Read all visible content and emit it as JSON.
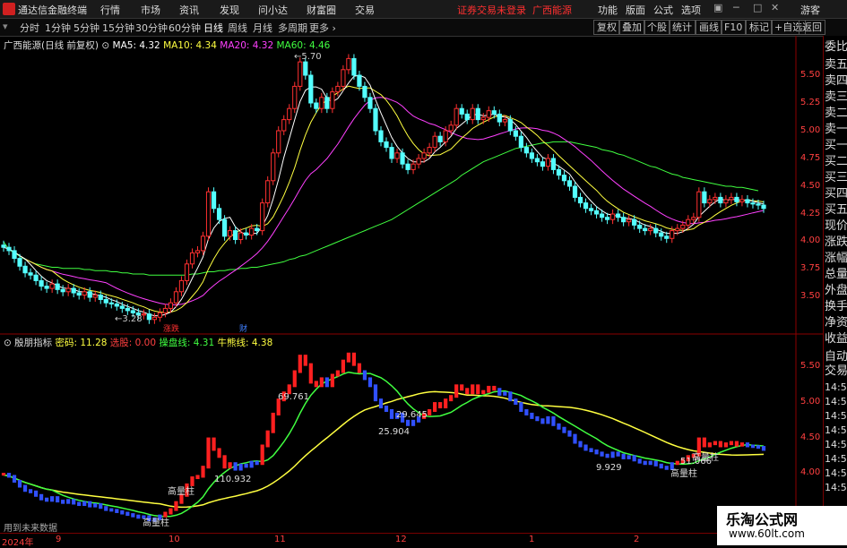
{
  "app": {
    "title": "通达信金融终端",
    "notice": "证券交易未登录",
    "stock_name": "广西能源"
  },
  "menu": [
    "行情",
    "市场",
    "资讯",
    "发现",
    "问小达",
    "财富圈",
    "交易"
  ],
  "right_menu": [
    "功能",
    "版面",
    "公式",
    "选项",
    "游客"
  ],
  "periods": [
    "分时",
    "1分钟",
    "5分钟",
    "15分钟",
    "30分钟",
    "60分钟",
    "日线",
    "周线",
    "月线",
    "多周期",
    "更多"
  ],
  "active_period": "日线",
  "toolbar": [
    "复权",
    "叠加",
    "个股",
    "统计",
    "画线",
    "F10",
    "标记",
    "+自选",
    "返回"
  ],
  "main_legend": {
    "title": "广西能源(日线 前复权)",
    "ma5": "MA5: 4.32",
    "ma10": "MA10: 4.34",
    "ma20": "MA20: 4.32",
    "ma60": "MA60: 4.46"
  },
  "price_marks": {
    "high": "5.70",
    "low": "3.28"
  },
  "event_marks": {
    "red": "涨跌",
    "blue": "财"
  },
  "indicator_legend": {
    "name": "殷朋指标",
    "mima": "密码: 11.28",
    "xuangu": "选股: 0.00",
    "caopan": "操盘线: 4.31",
    "niuxiong": "牛熊线: 4.38"
  },
  "indicator_marks": [
    "69.761",
    "29.645",
    "25.904",
    "110.932",
    "9.929",
    "51.066"
  ],
  "indicator_tags": [
    "高量柱",
    "高量柱",
    "高量柱",
    "高量柱"
  ],
  "price_axis": [
    "5.50",
    "5.25",
    "5.00",
    "4.75",
    "4.50",
    "4.25",
    "4.00",
    "3.75",
    "3.50"
  ],
  "ind_axis": [
    "5.50",
    "5.00",
    "4.50",
    "4.00"
  ],
  "right_panel_main": [
    "委比",
    "卖五",
    "卖四",
    "卖三",
    "卖二",
    "卖一",
    "买一",
    "买二",
    "买三",
    "买四",
    "买五",
    "现价",
    "涨跌",
    "涨幅",
    "总量",
    "外盘",
    "换手",
    "净资",
    "收益"
  ],
  "right_panel_sub": [
    "自动",
    "交易",
    "14:56",
    "14:56",
    "14:56",
    "14:56",
    "14:56",
    "14:56",
    "14:56",
    "14:56"
  ],
  "bottom_text": "用到未来数据",
  "dates": [
    "2024年",
    "9",
    "10",
    "11",
    "12",
    "1",
    "2"
  ],
  "watermark": {
    "line1": "乐淘公式网",
    "line2": "www.60lt.com"
  },
  "colors": {
    "up": "#ff3030",
    "down": "#54ffff",
    "ma5": "#ffffff",
    "ma10": "#ffff40",
    "ma20": "#ff40ff",
    "ma60": "#40ff40"
  },
  "chart_data": {
    "type": "candlestick",
    "closes": [
      3.95,
      3.92,
      3.85,
      3.78,
      3.72,
      3.7,
      3.65,
      3.6,
      3.58,
      3.62,
      3.57,
      3.55,
      3.58,
      3.54,
      3.52,
      3.55,
      3.5,
      3.52,
      3.48,
      3.45,
      3.44,
      3.42,
      3.4,
      3.38,
      3.36,
      3.34,
      3.35,
      3.3,
      3.32,
      3.36,
      3.4,
      3.45,
      3.55,
      3.65,
      3.8,
      3.9,
      3.92,
      4.05,
      4.45,
      4.3,
      4.2,
      4.05,
      4.1,
      4.02,
      4.08,
      4.06,
      4.12,
      4.1,
      4.35,
      4.55,
      4.8,
      5.0,
      5.1,
      5.2,
      5.4,
      5.62,
      5.5,
      5.25,
      5.2,
      5.3,
      5.2,
      5.35,
      5.4,
      5.55,
      5.65,
      5.5,
      5.4,
      5.3,
      5.2,
      5.0,
      4.9,
      4.85,
      4.75,
      4.8,
      4.7,
      4.65,
      4.7,
      4.75,
      4.8,
      4.85,
      4.95,
      4.9,
      5.0,
      5.05,
      5.2,
      5.15,
      5.1,
      5.2,
      5.1,
      5.12,
      5.18,
      5.15,
      5.08,
      5.1,
      5.0,
      4.95,
      4.85,
      4.8,
      4.75,
      4.72,
      4.68,
      4.75,
      4.65,
      4.6,
      4.55,
      4.5,
      4.4,
      4.35,
      4.3,
      4.28,
      4.25,
      4.22,
      4.2,
      4.25,
      4.22,
      4.18,
      4.2,
      4.15,
      4.12,
      4.1,
      4.12,
      4.08,
      4.05,
      4.03,
      4.1,
      4.12,
      4.15,
      4.2,
      4.22,
      4.45,
      4.35,
      4.38,
      4.4,
      4.35,
      4.38,
      4.4,
      4.36,
      4.38,
      4.35,
      4.34,
      4.33,
      4.3
    ],
    "ma60": [
      4.0,
      3.93,
      3.9,
      3.87,
      3.84,
      3.82,
      3.8,
      3.79,
      3.78,
      3.77,
      3.77,
      3.76,
      3.76,
      3.76,
      3.76,
      3.75,
      3.75,
      3.74,
      3.74,
      3.74,
      3.73,
      3.73,
      3.72,
      3.72,
      3.71,
      3.71,
      3.71,
      3.7,
      3.7,
      3.7,
      3.7,
      3.7,
      3.7,
      3.7,
      3.7,
      3.71,
      3.71,
      3.72,
      3.73,
      3.73,
      3.74,
      3.74,
      3.75,
      3.75,
      3.76,
      3.76,
      3.77,
      3.77,
      3.78,
      3.79,
      3.8,
      3.81,
      3.82,
      3.84,
      3.85,
      3.87,
      3.88,
      3.9,
      3.92,
      3.94,
      3.96,
      3.98,
      4.0,
      4.02,
      4.04,
      4.06,
      4.08,
      4.1,
      4.12,
      4.14,
      4.16,
      4.18,
      4.2,
      4.23,
      4.26,
      4.29,
      4.32,
      4.35,
      4.38,
      4.41,
      4.44,
      4.47,
      4.5,
      4.53,
      4.56,
      4.6,
      4.63,
      4.66,
      4.69,
      4.72,
      4.74,
      4.76,
      4.78,
      4.8,
      4.82,
      4.84,
      4.85,
      4.86,
      4.87,
      4.88,
      4.89,
      4.89,
      4.9,
      4.9,
      4.9,
      4.9,
      4.89,
      4.88,
      4.87,
      4.86,
      4.85,
      4.83,
      4.82,
      4.81,
      4.79,
      4.78,
      4.76,
      4.74,
      4.72,
      4.7,
      4.68,
      4.67,
      4.65,
      4.63,
      4.61,
      4.6,
      4.58,
      4.57,
      4.56,
      4.55,
      4.54,
      4.53,
      4.52,
      4.51,
      4.5,
      4.5,
      4.49,
      4.49,
      4.48,
      4.47,
      4.46
    ]
  }
}
